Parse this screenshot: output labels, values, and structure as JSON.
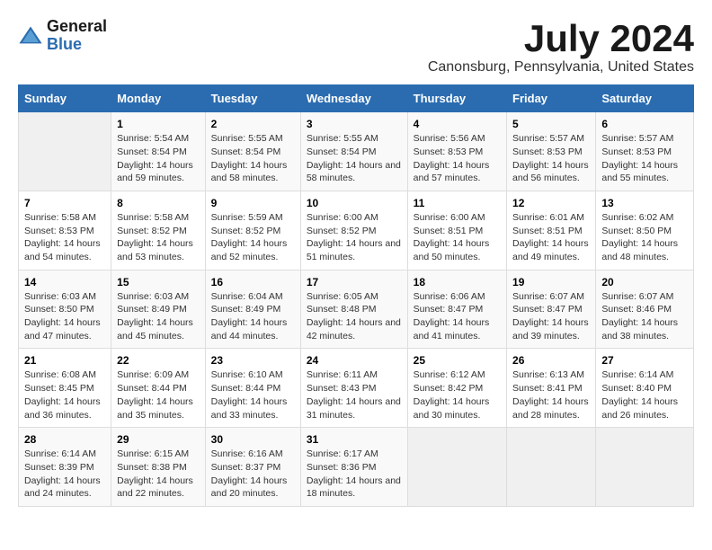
{
  "logo": {
    "text_general": "General",
    "text_blue": "Blue"
  },
  "title": "July 2024",
  "subtitle": "Canonsburg, Pennsylvania, United States",
  "calendar": {
    "headers": [
      "Sunday",
      "Monday",
      "Tuesday",
      "Wednesday",
      "Thursday",
      "Friday",
      "Saturday"
    ],
    "rows": [
      [
        {
          "day": "",
          "sunrise": "",
          "sunset": "",
          "daylight": "",
          "empty": true
        },
        {
          "day": "1",
          "sunrise": "Sunrise: 5:54 AM",
          "sunset": "Sunset: 8:54 PM",
          "daylight": "Daylight: 14 hours and 59 minutes."
        },
        {
          "day": "2",
          "sunrise": "Sunrise: 5:55 AM",
          "sunset": "Sunset: 8:54 PM",
          "daylight": "Daylight: 14 hours and 58 minutes."
        },
        {
          "day": "3",
          "sunrise": "Sunrise: 5:55 AM",
          "sunset": "Sunset: 8:54 PM",
          "daylight": "Daylight: 14 hours and 58 minutes."
        },
        {
          "day": "4",
          "sunrise": "Sunrise: 5:56 AM",
          "sunset": "Sunset: 8:53 PM",
          "daylight": "Daylight: 14 hours and 57 minutes."
        },
        {
          "day": "5",
          "sunrise": "Sunrise: 5:57 AM",
          "sunset": "Sunset: 8:53 PM",
          "daylight": "Daylight: 14 hours and 56 minutes."
        },
        {
          "day": "6",
          "sunrise": "Sunrise: 5:57 AM",
          "sunset": "Sunset: 8:53 PM",
          "daylight": "Daylight: 14 hours and 55 minutes."
        }
      ],
      [
        {
          "day": "7",
          "sunrise": "Sunrise: 5:58 AM",
          "sunset": "Sunset: 8:53 PM",
          "daylight": "Daylight: 14 hours and 54 minutes."
        },
        {
          "day": "8",
          "sunrise": "Sunrise: 5:58 AM",
          "sunset": "Sunset: 8:52 PM",
          "daylight": "Daylight: 14 hours and 53 minutes."
        },
        {
          "day": "9",
          "sunrise": "Sunrise: 5:59 AM",
          "sunset": "Sunset: 8:52 PM",
          "daylight": "Daylight: 14 hours and 52 minutes."
        },
        {
          "day": "10",
          "sunrise": "Sunrise: 6:00 AM",
          "sunset": "Sunset: 8:52 PM",
          "daylight": "Daylight: 14 hours and 51 minutes."
        },
        {
          "day": "11",
          "sunrise": "Sunrise: 6:00 AM",
          "sunset": "Sunset: 8:51 PM",
          "daylight": "Daylight: 14 hours and 50 minutes."
        },
        {
          "day": "12",
          "sunrise": "Sunrise: 6:01 AM",
          "sunset": "Sunset: 8:51 PM",
          "daylight": "Daylight: 14 hours and 49 minutes."
        },
        {
          "day": "13",
          "sunrise": "Sunrise: 6:02 AM",
          "sunset": "Sunset: 8:50 PM",
          "daylight": "Daylight: 14 hours and 48 minutes."
        }
      ],
      [
        {
          "day": "14",
          "sunrise": "Sunrise: 6:03 AM",
          "sunset": "Sunset: 8:50 PM",
          "daylight": "Daylight: 14 hours and 47 minutes."
        },
        {
          "day": "15",
          "sunrise": "Sunrise: 6:03 AM",
          "sunset": "Sunset: 8:49 PM",
          "daylight": "Daylight: 14 hours and 45 minutes."
        },
        {
          "day": "16",
          "sunrise": "Sunrise: 6:04 AM",
          "sunset": "Sunset: 8:49 PM",
          "daylight": "Daylight: 14 hours and 44 minutes."
        },
        {
          "day": "17",
          "sunrise": "Sunrise: 6:05 AM",
          "sunset": "Sunset: 8:48 PM",
          "daylight": "Daylight: 14 hours and 42 minutes."
        },
        {
          "day": "18",
          "sunrise": "Sunrise: 6:06 AM",
          "sunset": "Sunset: 8:47 PM",
          "daylight": "Daylight: 14 hours and 41 minutes."
        },
        {
          "day": "19",
          "sunrise": "Sunrise: 6:07 AM",
          "sunset": "Sunset: 8:47 PM",
          "daylight": "Daylight: 14 hours and 39 minutes."
        },
        {
          "day": "20",
          "sunrise": "Sunrise: 6:07 AM",
          "sunset": "Sunset: 8:46 PM",
          "daylight": "Daylight: 14 hours and 38 minutes."
        }
      ],
      [
        {
          "day": "21",
          "sunrise": "Sunrise: 6:08 AM",
          "sunset": "Sunset: 8:45 PM",
          "daylight": "Daylight: 14 hours and 36 minutes."
        },
        {
          "day": "22",
          "sunrise": "Sunrise: 6:09 AM",
          "sunset": "Sunset: 8:44 PM",
          "daylight": "Daylight: 14 hours and 35 minutes."
        },
        {
          "day": "23",
          "sunrise": "Sunrise: 6:10 AM",
          "sunset": "Sunset: 8:44 PM",
          "daylight": "Daylight: 14 hours and 33 minutes."
        },
        {
          "day": "24",
          "sunrise": "Sunrise: 6:11 AM",
          "sunset": "Sunset: 8:43 PM",
          "daylight": "Daylight: 14 hours and 31 minutes."
        },
        {
          "day": "25",
          "sunrise": "Sunrise: 6:12 AM",
          "sunset": "Sunset: 8:42 PM",
          "daylight": "Daylight: 14 hours and 30 minutes."
        },
        {
          "day": "26",
          "sunrise": "Sunrise: 6:13 AM",
          "sunset": "Sunset: 8:41 PM",
          "daylight": "Daylight: 14 hours and 28 minutes."
        },
        {
          "day": "27",
          "sunrise": "Sunrise: 6:14 AM",
          "sunset": "Sunset: 8:40 PM",
          "daylight": "Daylight: 14 hours and 26 minutes."
        }
      ],
      [
        {
          "day": "28",
          "sunrise": "Sunrise: 6:14 AM",
          "sunset": "Sunset: 8:39 PM",
          "daylight": "Daylight: 14 hours and 24 minutes."
        },
        {
          "day": "29",
          "sunrise": "Sunrise: 6:15 AM",
          "sunset": "Sunset: 8:38 PM",
          "daylight": "Daylight: 14 hours and 22 minutes."
        },
        {
          "day": "30",
          "sunrise": "Sunrise: 6:16 AM",
          "sunset": "Sunset: 8:37 PM",
          "daylight": "Daylight: 14 hours and 20 minutes."
        },
        {
          "day": "31",
          "sunrise": "Sunrise: 6:17 AM",
          "sunset": "Sunset: 8:36 PM",
          "daylight": "Daylight: 14 hours and 18 minutes."
        },
        {
          "day": "",
          "sunrise": "",
          "sunset": "",
          "daylight": "",
          "empty": true
        },
        {
          "day": "",
          "sunrise": "",
          "sunset": "",
          "daylight": "",
          "empty": true
        },
        {
          "day": "",
          "sunrise": "",
          "sunset": "",
          "daylight": "",
          "empty": true
        }
      ]
    ]
  }
}
